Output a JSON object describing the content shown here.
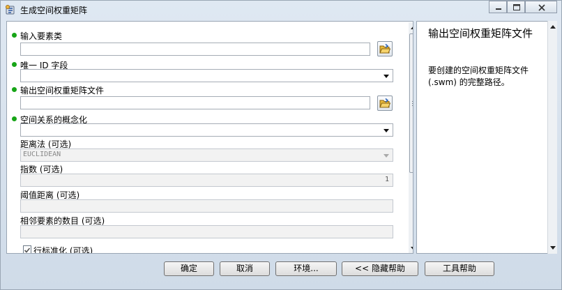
{
  "window": {
    "title": "生成空间权重矩阵"
  },
  "form": {
    "input_features": {
      "label": "输入要素类",
      "value": ""
    },
    "unique_id": {
      "label": "唯一 ID 字段",
      "value": ""
    },
    "output_file": {
      "label": "输出空间权重矩阵文件",
      "value": ""
    },
    "conceptualization": {
      "label": "空间关系的概念化",
      "value": ""
    },
    "distance_method": {
      "label": "距离法 (可选)",
      "value": "EUCLIDEAN"
    },
    "exponent": {
      "label": "指数 (可选)",
      "value": "1"
    },
    "threshold": {
      "label": "阈值距离 (可选)",
      "value": ""
    },
    "neighbors": {
      "label": "相邻要素的数目 (可选)",
      "value": ""
    },
    "row_standardization": {
      "label": "行标准化 (可选)",
      "checked": true
    }
  },
  "help": {
    "title": "输出空间权重矩阵文件",
    "body": "要创建的空间权重矩阵文件 (.swm) 的完整路径。"
  },
  "buttons": {
    "ok": "确定",
    "cancel": "取消",
    "environments": "环境...",
    "hide_help": "<< 隐藏帮助",
    "tool_help": "工具帮助"
  },
  "colors": {
    "required_dot": "#17a517",
    "pane_bg": "#ffffff",
    "frame_bg": "#dfe8f2"
  },
  "icons": {
    "app": "arcgis-toolbox-icon",
    "browse": "open-folder-icon"
  }
}
